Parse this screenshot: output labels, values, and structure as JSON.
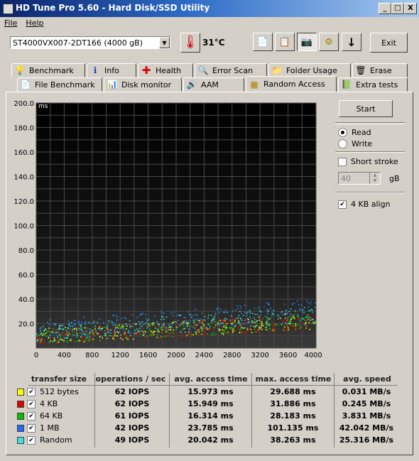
{
  "window": {
    "title": "HD Tune Pro 5.60 - Hard Disk/SSD Utility",
    "min": "_",
    "max": "□",
    "close": "X"
  },
  "menu": {
    "file": "File",
    "help": "Help"
  },
  "toolbar": {
    "drive": "ST4000VX007-2DT166 (4000 gB)",
    "temperature": "31°C",
    "exit": "Exit"
  },
  "tabs_top": [
    "Benchmark",
    "Info",
    "Health",
    "Error Scan",
    "Folder Usage",
    "Erase"
  ],
  "tabs_bottom": [
    "File Benchmark",
    "Disk monitor",
    "AAM",
    "Random Access",
    "Extra tests"
  ],
  "side": {
    "start": "Start",
    "read": "Read",
    "write": "Write",
    "short_stroke": "Short stroke",
    "stroke_value": "40",
    "unit": "gB",
    "align": "4 KB align"
  },
  "chart_data": {
    "type": "scatter",
    "ylabel": "ms",
    "xunit": "gB",
    "xlim": [
      0,
      4000
    ],
    "ylim": [
      0,
      200
    ],
    "xticks": [
      "0",
      "400",
      "800",
      "1200",
      "1600",
      "2000",
      "2400",
      "2800",
      "3200",
      "3600",
      "4000gB"
    ],
    "yticks": [
      "200.0",
      "180.0",
      "160.0",
      "140.0",
      "120.0",
      "100.0",
      "80.0",
      "60.0",
      "40.0",
      "20.0"
    ],
    "grid": true,
    "series": [
      {
        "name": "512 bytes",
        "color": "#ffff00",
        "avg_ms": 15.973
      },
      {
        "name": "4 KB",
        "color": "#ff0000",
        "avg_ms": 15.949
      },
      {
        "name": "64 KB",
        "color": "#00d000",
        "avg_ms": 16.314
      },
      {
        "name": "1 MB",
        "color": "#1e8cff",
        "avg_ms": 23.785
      },
      {
        "name": "Random",
        "color": "#40e0e0",
        "avg_ms": 20.042
      }
    ]
  },
  "results": {
    "headers": [
      "transfer size",
      "operations / sec",
      "avg. access time",
      "max. access time",
      "avg. speed"
    ],
    "rows": [
      {
        "color": "#ffff00",
        "label": "512 bytes",
        "ops": "62 IOPS",
        "avg": "15.973 ms",
        "max": "29.688 ms",
        "speed": "0.031 MB/s"
      },
      {
        "color": "#e00000",
        "label": "4 KB",
        "ops": "62 IOPS",
        "avg": "15.949 ms",
        "max": "31.886 ms",
        "speed": "0.245 MB/s"
      },
      {
        "color": "#00c000",
        "label": "64 KB",
        "ops": "61 IOPS",
        "avg": "16.314 ms",
        "max": "28.183 ms",
        "speed": "3.831 MB/s"
      },
      {
        "color": "#1e6cff",
        "label": "1 MB",
        "ops": "42 IOPS",
        "avg": "23.785 ms",
        "max": "101.135 ms",
        "speed": "42.042 MB/s"
      },
      {
        "color": "#40e0e0",
        "label": "Random",
        "ops": "49 IOPS",
        "avg": "20.042 ms",
        "max": "38.263 ms",
        "speed": "25.316 MB/s"
      }
    ]
  }
}
